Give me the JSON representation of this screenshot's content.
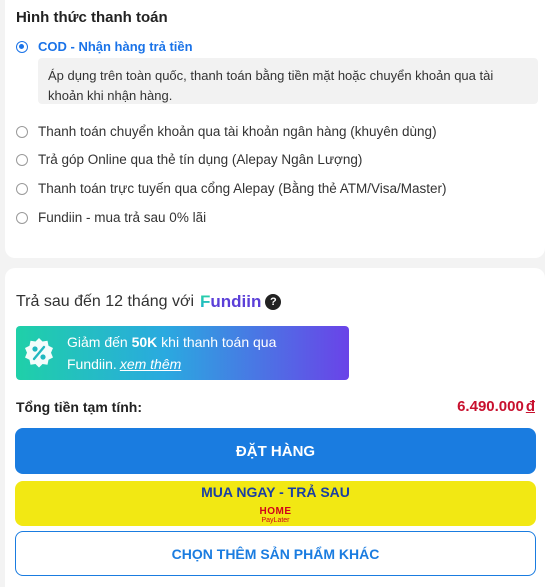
{
  "payment": {
    "title": "Hình thức thanh toán",
    "options": [
      {
        "label": "COD - Nhận hàng trả tiền",
        "selected": true
      },
      {
        "label": "Thanh toán chuyển khoản qua tài khoản ngân hàng (khuyên dùng)",
        "selected": false
      },
      {
        "label": "Trả góp Online qua thẻ tín dụng (Alepay Ngân Lượng)",
        "selected": false
      },
      {
        "label": "Thanh toán trực tuyến qua cổng Alepay (Bằng thẻ ATM/Visa/Master)",
        "selected": false
      },
      {
        "label": "Fundiin - mua trả sau 0% lãi",
        "selected": false
      }
    ],
    "cod_description": "Áp dụng trên toàn quốc, thanh toán bằng tiền mặt hoặc chuyển khoản qua tài khoản khi nhận hàng."
  },
  "fundiin": {
    "intro": "Trả sau đến 12 tháng với",
    "logo_first": "F",
    "logo_rest": "undiin",
    "help_icon": "?",
    "promo_prefix": "Giảm đến",
    "promo_amount": "50K",
    "promo_suffix": "khi thanh toán qua",
    "promo_line2": "Fundiin.",
    "promo_link": "xem thêm"
  },
  "summary": {
    "total_label": "Tổng tiền tạm tính:",
    "total_value": "6.490.000",
    "currency": "đ"
  },
  "buttons": {
    "order": "ĐẶT HÀNG",
    "bnpl": "MUA NGAY - TRẢ SAU",
    "bnpl_logo_top": "HOME",
    "bnpl_logo_bottom": "PayLater",
    "more": "CHỌN THÊM SẢN PHẨM KHÁC"
  },
  "colors": {
    "accent_blue": "#1a7ce0",
    "price_red": "#c8102e",
    "bnpl_yellow": "#f2e813"
  }
}
